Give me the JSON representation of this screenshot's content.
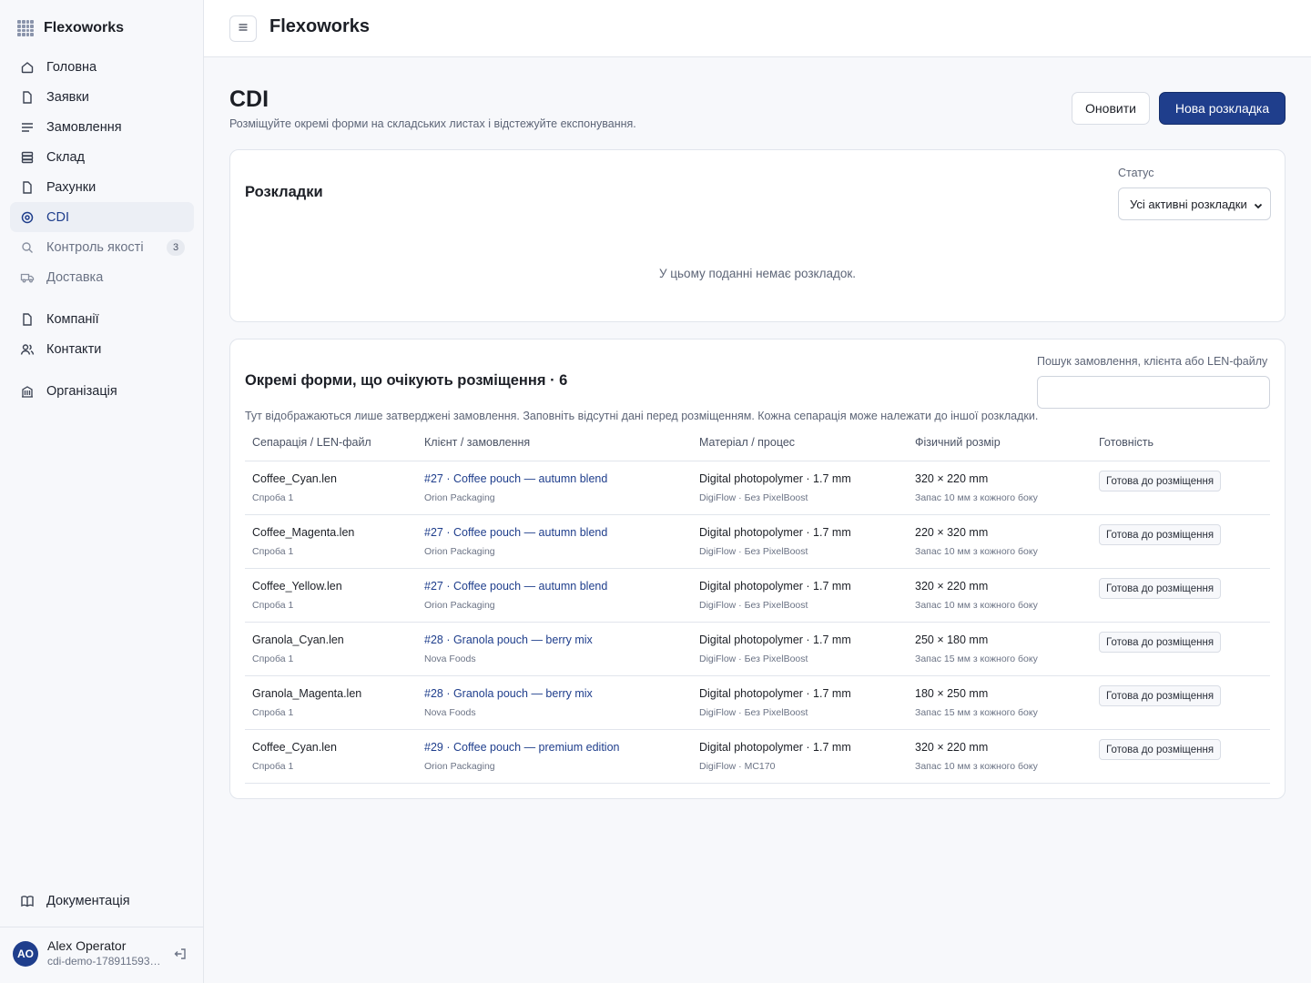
{
  "app": {
    "name": "Flexoworks"
  },
  "sidebar": {
    "items": [
      {
        "label": "Головна",
        "icon": "home-icon"
      },
      {
        "label": "Заявки",
        "icon": "file-icon"
      },
      {
        "label": "Замовлення",
        "icon": "list-icon"
      },
      {
        "label": "Склад",
        "icon": "database-icon"
      },
      {
        "label": "Рахунки",
        "icon": "file-icon"
      },
      {
        "label": "CDI",
        "icon": "target-icon",
        "active": true
      },
      {
        "label": "Контроль якості",
        "icon": "search-icon",
        "badge": "3"
      },
      {
        "label": "Доставка",
        "icon": "truck-icon"
      },
      {
        "label": "Компанії",
        "icon": "building-icon"
      },
      {
        "label": "Контакти",
        "icon": "users-icon"
      },
      {
        "label": "Організація",
        "icon": "organization-icon"
      }
    ],
    "docs_label": "Документація",
    "user": {
      "initials": "AO",
      "name": "Alex Operator",
      "sub": "cdi-demo-1789115937..."
    }
  },
  "topbar": {
    "title": "Flexoworks"
  },
  "page": {
    "title": "CDI",
    "subtitle": "Розміщуйте окремі форми на складських листах і відстежуйте експонування.",
    "refresh_label": "Оновити",
    "new_label": "Нова розкладка"
  },
  "layouts": {
    "title": "Розкладки",
    "status_label": "Статус",
    "status_value": "Усі активні розкладки",
    "empty": "У цьому поданні немає розкладок."
  },
  "pending": {
    "title": "Окремі форми, що очікують розміщення · 6",
    "search_label": "Пошук замовлення, клієнта або LEN-файлу",
    "search_placeholder": "",
    "description": "Тут відображаються лише затверджені замовлення. Заповніть відсутні дані перед розміщенням. Кожна сепарація може належати до іншої розкладки.",
    "columns": [
      "Сепарація / LEN-файл",
      "Клієнт / замовлення",
      "Матеріал / процес",
      "Фізичний розмір",
      "Готовність"
    ],
    "rows": [
      {
        "file": "Coffee_Cyan.len",
        "attempt": "Спроба 1",
        "order": "#27 · Coffee pouch — autumn blend",
        "client": "Orion Packaging",
        "material": "Digital photopolymer · 1.7 mm",
        "process": "DigiFlow · Без PixelBoost",
        "size": "320 × 220 mm",
        "margin": "Запас 10 мм з кожного боку",
        "status": "Готова до розміщення"
      },
      {
        "file": "Coffee_Magenta.len",
        "attempt": "Спроба 1",
        "order": "#27 · Coffee pouch — autumn blend",
        "client": "Orion Packaging",
        "material": "Digital photopolymer · 1.7 mm",
        "process": "DigiFlow · Без PixelBoost",
        "size": "220 × 320 mm",
        "margin": "Запас 10 мм з кожного боку",
        "status": "Готова до розміщення"
      },
      {
        "file": "Coffee_Yellow.len",
        "attempt": "Спроба 1",
        "order": "#27 · Coffee pouch — autumn blend",
        "client": "Orion Packaging",
        "material": "Digital photopolymer · 1.7 mm",
        "process": "DigiFlow · Без PixelBoost",
        "size": "320 × 220 mm",
        "margin": "Запас 10 мм з кожного боку",
        "status": "Готова до розміщення"
      },
      {
        "file": "Granola_Cyan.len",
        "attempt": "Спроба 1",
        "order": "#28 · Granola pouch — berry mix",
        "client": "Nova Foods",
        "material": "Digital photopolymer · 1.7 mm",
        "process": "DigiFlow · Без PixelBoost",
        "size": "250 × 180 mm",
        "margin": "Запас 15 мм з кожного боку",
        "status": "Готова до розміщення"
      },
      {
        "file": "Granola_Magenta.len",
        "attempt": "Спроба 1",
        "order": "#28 · Granola pouch — berry mix",
        "client": "Nova Foods",
        "material": "Digital photopolymer · 1.7 mm",
        "process": "DigiFlow · Без PixelBoost",
        "size": "180 × 250 mm",
        "margin": "Запас 15 мм з кожного боку",
        "status": "Готова до розміщення"
      },
      {
        "file": "Coffee_Cyan.len",
        "attempt": "Спроба 1",
        "order": "#29 · Coffee pouch — premium edition",
        "client": "Orion Packaging",
        "material": "Digital photopolymer · 1.7 mm",
        "process": "DigiFlow · MC170",
        "size": "320 × 220 mm",
        "margin": "Запас 10 мм з кожного боку",
        "status": "Готова до розміщення"
      }
    ]
  },
  "colors": {
    "accent": "#1f3e8c",
    "background": "#f7f8fb",
    "border": "#e1e5ec"
  }
}
